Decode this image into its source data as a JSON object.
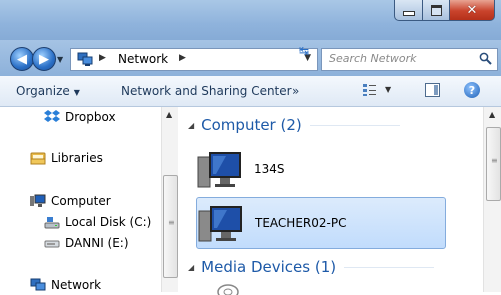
{
  "window": {
    "minimize_icon": "minimize-icon",
    "maximize_icon": "maximize-icon",
    "close_glyph": "✕"
  },
  "address_bar": {
    "location": "Network",
    "search_placeholder": "Search Network"
  },
  "toolbar": {
    "organize": "Organize",
    "network_sharing": "Network and Sharing Center",
    "more": "»"
  },
  "nav_pane": {
    "items": [
      {
        "label": "Dropbox",
        "icon": "dropbox-icon"
      },
      {
        "label": "Libraries",
        "icon": "libraries-icon"
      },
      {
        "label": "Computer",
        "icon": "computer-icon"
      },
      {
        "label": "Local Disk (C:)",
        "icon": "local-disk-icon"
      },
      {
        "label": "DANNI (E:)",
        "icon": "removable-drive-icon"
      },
      {
        "label": "Network",
        "icon": "network-icon"
      }
    ]
  },
  "content": {
    "groups": [
      {
        "title": "Computer (2)",
        "items": [
          "134S",
          "TEACHER02-PC"
        ]
      },
      {
        "title": "Media Devices (1)",
        "items": []
      }
    ],
    "selected_item": "TEACHER02-PC"
  },
  "colors": {
    "accent": "#1e5aa8",
    "selection": "#c1dcfc",
    "titlebar": "#8fb3dc",
    "close": "#c9432c"
  }
}
